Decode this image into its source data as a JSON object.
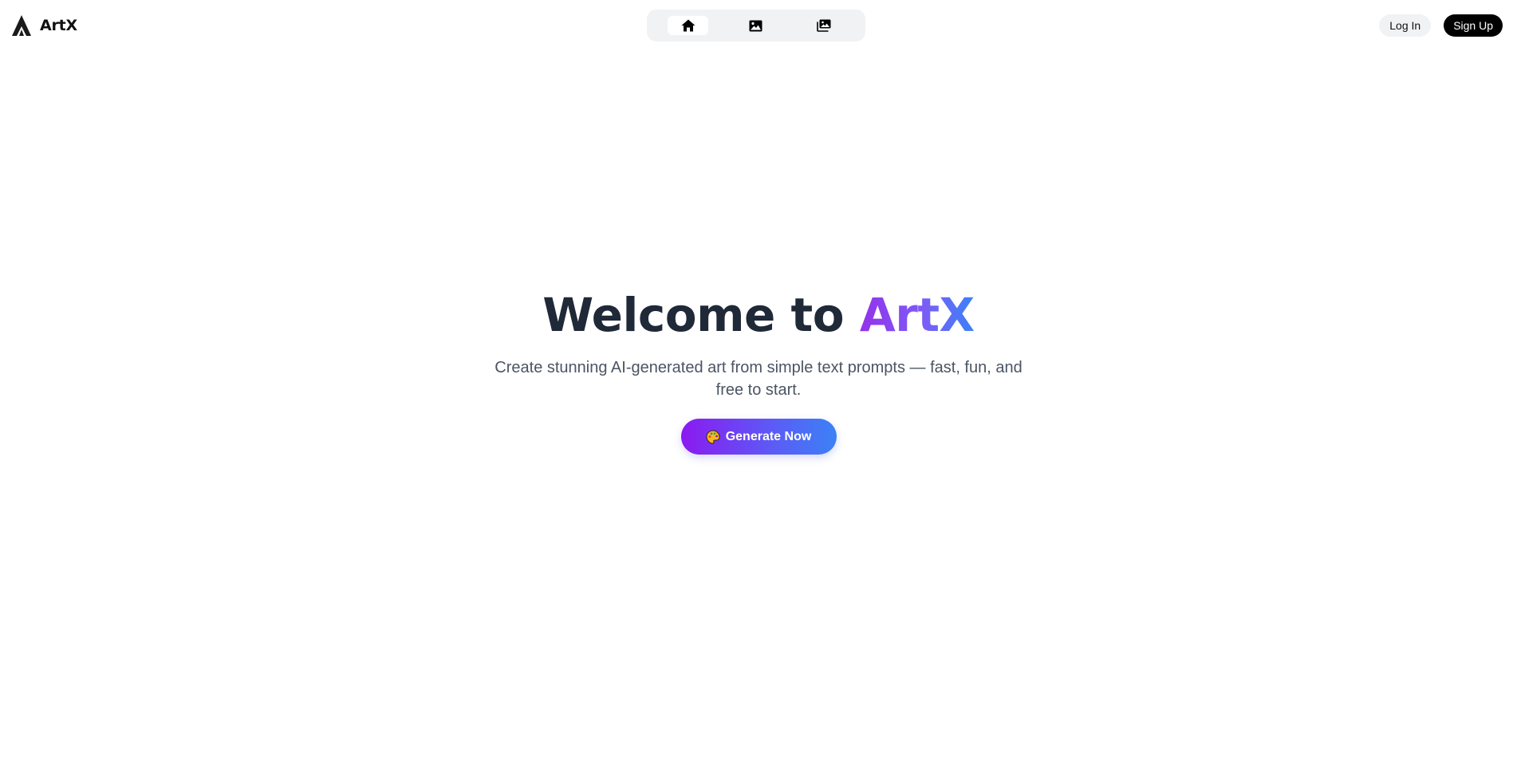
{
  "brand": {
    "name": "ArtX",
    "logo_icon": "artx-logo-icon"
  },
  "nav": {
    "items": [
      {
        "id": "home",
        "icon": "home-icon",
        "active": true
      },
      {
        "id": "gallery",
        "icon": "image-icon",
        "active": false
      },
      {
        "id": "collection",
        "icon": "images-stack-icon",
        "active": false
      }
    ]
  },
  "auth": {
    "login_label": "Log In",
    "signup_label": "Sign Up"
  },
  "hero": {
    "title_prefix": "Welcome to ",
    "title_accent": "ArtX",
    "subtitle": "Create stunning AI-generated art from simple text prompts — fast, fun, and free to start.",
    "cta_label": "Generate Now",
    "cta_icon": "palette-icon"
  },
  "colors": {
    "accent_gradient_start": "#9333ea",
    "accent_gradient_end": "#3b82f6",
    "title_color": "#1f2937",
    "signup_bg": "#000000",
    "nav_bg": "#f1f2f4"
  }
}
